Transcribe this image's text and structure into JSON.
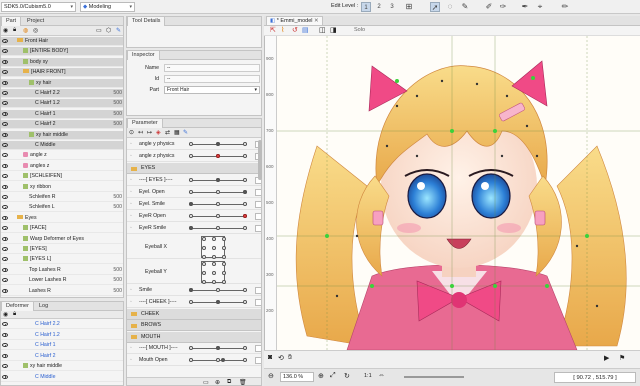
{
  "topbar": {
    "sdk_dropdown": "SDK5.0/Cubism5.0",
    "mode_dropdown": "Modeling",
    "edit_level_label": "Edit Level :",
    "edit_levels": [
      "1",
      "2",
      "3"
    ]
  },
  "left_panel": {
    "tabs": [
      "Part",
      "Project"
    ],
    "rows": [
      {
        "label": "Front Hair",
        "type": "folder",
        "indent": 1,
        "gray": true
      },
      {
        "label": "[ENTIRE BODY]",
        "type": "warp",
        "indent": 2,
        "gray": true
      },
      {
        "label": "body xy",
        "type": "warp",
        "indent": 2,
        "gray": true
      },
      {
        "label": "[HAIR FRONT]",
        "type": "folder",
        "indent": 2,
        "gray": true
      },
      {
        "label": "xy hair",
        "type": "warp",
        "indent": 3,
        "gray": true
      },
      {
        "label": "C Hairf 2.2",
        "type": "text",
        "indent": 4,
        "num": "500",
        "gray": true
      },
      {
        "label": "C Hairf 1.2",
        "type": "text",
        "indent": 4,
        "num": "500",
        "gray": true
      },
      {
        "label": "C Hairf 1",
        "type": "text",
        "indent": 4,
        "num": "500",
        "gray": true
      },
      {
        "label": "C Hairf 2",
        "type": "text",
        "indent": 4,
        "num": "500",
        "gray": true
      },
      {
        "label": "xy hair middle",
        "type": "warp",
        "indent": 3,
        "gray": true
      },
      {
        "label": "C Middle",
        "type": "text",
        "indent": 4,
        "num": "",
        "gray": true
      },
      {
        "label": "angle z",
        "type": "mesh",
        "indent": 2,
        "gray": false
      },
      {
        "label": "angles z",
        "type": "mesh",
        "indent": 2,
        "gray": false
      },
      {
        "label": "[SCHLEIFEN]",
        "type": "warp",
        "indent": 2,
        "gray": false
      },
      {
        "label": "xy ribbon",
        "type": "warp",
        "indent": 2,
        "gray": false
      },
      {
        "label": "Schleifen R",
        "type": "text",
        "indent": 3,
        "num": "500",
        "gray": false
      },
      {
        "label": "Schleifen L",
        "type": "text",
        "indent": 3,
        "num": "500",
        "gray": false
      },
      {
        "label": "Eyes",
        "type": "folder",
        "indent": 1,
        "gray": false
      },
      {
        "label": "[FACE]",
        "type": "warp",
        "indent": 2,
        "gray": false
      },
      {
        "label": "Warp Deformer of Eyes",
        "type": "warp",
        "indent": 2,
        "gray": false
      },
      {
        "label": "[EYES]",
        "type": "warp",
        "indent": 2,
        "gray": false
      },
      {
        "label": "[EYES L]",
        "type": "warp",
        "indent": 2,
        "gray": false
      },
      {
        "label": "Top Lashes R",
        "type": "text",
        "indent": 3,
        "num": "500",
        "gray": false
      },
      {
        "label": "Lower Lashes R",
        "type": "text",
        "indent": 3,
        "num": "500",
        "gray": false
      },
      {
        "label": "Lashes R",
        "type": "text",
        "indent": 3,
        "num": "500",
        "gray": false
      }
    ]
  },
  "deformer_panel": {
    "tabs": [
      "Deformer",
      "Log"
    ],
    "rows": [
      {
        "label": "C Hairf 2.2",
        "blue": true,
        "indent": 4
      },
      {
        "label": "C Hairf 1.2",
        "blue": true,
        "indent": 4
      },
      {
        "label": "C Hairf 1",
        "blue": true,
        "indent": 4
      },
      {
        "label": "C Hairf 2",
        "blue": true,
        "indent": 4
      },
      {
        "label": "xy hair middle",
        "blue": false,
        "indent": 2
      },
      {
        "label": "C Middle",
        "blue": true,
        "indent": 4
      }
    ]
  },
  "tool_details": {
    "tab": "Tool Details"
  },
  "inspector": {
    "tab": "Inspector",
    "fields": [
      {
        "label": "Name",
        "value": "--"
      },
      {
        "label": "Id",
        "value": "--"
      },
      {
        "label": "Part",
        "value": "Front Hair"
      }
    ]
  },
  "parameter": {
    "tab": "Parameter",
    "rows": [
      {
        "kind": "param",
        "label": "angle y physics",
        "value": "0.0",
        "knob": 0.5,
        "red": false
      },
      {
        "kind": "param",
        "label": "angle z physics",
        "value": "0.0",
        "knob": 0.5,
        "red": true
      },
      {
        "kind": "group",
        "label": "EYES"
      },
      {
        "kind": "param",
        "label": "----[ EYES ]----",
        "value": "0.0",
        "knob": 0.5,
        "red": false
      },
      {
        "kind": "param",
        "label": "Eyel. Open",
        "value": "1.0",
        "knob": 1.0,
        "red": false
      },
      {
        "kind": "param",
        "label": "Eyel. Smile",
        "value": "0.0",
        "knob": 0.0,
        "red": false
      },
      {
        "kind": "param",
        "label": "EyeR Open",
        "value": "1.0",
        "knob": 1.0,
        "red": true
      },
      {
        "kind": "param",
        "label": "EyeR Smile",
        "value": "0.0",
        "knob": 0.0,
        "red": false
      },
      {
        "kind": "grid",
        "label": "Eyeball X",
        "value": ""
      },
      {
        "kind": "grid2",
        "label": "Eyeball Y",
        "value": ""
      },
      {
        "kind": "param",
        "label": "Smile",
        "value": "0.0",
        "knob": 0.0,
        "red": false
      },
      {
        "kind": "param",
        "label": "----[ CHEEK ]----",
        "value": "0.0",
        "knob": 0.5,
        "red": false
      },
      {
        "kind": "group",
        "label": "CHEEK"
      },
      {
        "kind": "group",
        "label": "BROWS"
      },
      {
        "kind": "group",
        "label": "MOUTH"
      },
      {
        "kind": "param",
        "label": "----[ MOUTH ]----",
        "value": "0.0",
        "knob": 0.5,
        "red": false
      },
      {
        "kind": "param",
        "label": "Mouth Open",
        "value": "0.6",
        "knob": 0.6,
        "red": false
      }
    ]
  },
  "canvas": {
    "tab": "* Emmi_model",
    "solo_label": "Solo",
    "ruler_labels": [
      "900",
      "800",
      "700",
      "600",
      "500",
      "400",
      "300",
      "200"
    ],
    "zoom": "136.0 %",
    "coords": "[ 90.72 , 515.79 ]",
    "playback_label": "1:1"
  },
  "colors": {
    "accent": "#3a6fd8",
    "hair": "#f5c45c",
    "dress": "#e0507a",
    "ribbon": "#e8407a"
  }
}
